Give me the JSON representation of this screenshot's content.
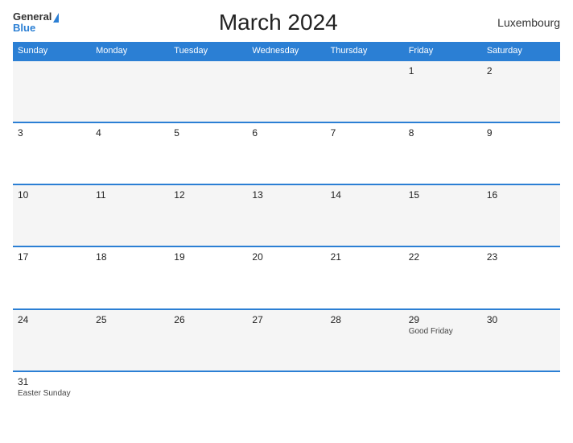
{
  "header": {
    "logo_general": "General",
    "logo_blue": "Blue",
    "title": "March 2024",
    "country": "Luxembourg"
  },
  "days_of_week": [
    "Sunday",
    "Monday",
    "Tuesday",
    "Wednesday",
    "Thursday",
    "Friday",
    "Saturday"
  ],
  "weeks": [
    [
      {
        "day": "",
        "event": ""
      },
      {
        "day": "",
        "event": ""
      },
      {
        "day": "",
        "event": ""
      },
      {
        "day": "",
        "event": ""
      },
      {
        "day": "",
        "event": ""
      },
      {
        "day": "1",
        "event": ""
      },
      {
        "day": "2",
        "event": ""
      }
    ],
    [
      {
        "day": "3",
        "event": ""
      },
      {
        "day": "4",
        "event": ""
      },
      {
        "day": "5",
        "event": ""
      },
      {
        "day": "6",
        "event": ""
      },
      {
        "day": "7",
        "event": ""
      },
      {
        "day": "8",
        "event": ""
      },
      {
        "day": "9",
        "event": ""
      }
    ],
    [
      {
        "day": "10",
        "event": ""
      },
      {
        "day": "11",
        "event": ""
      },
      {
        "day": "12",
        "event": ""
      },
      {
        "day": "13",
        "event": ""
      },
      {
        "day": "14",
        "event": ""
      },
      {
        "day": "15",
        "event": ""
      },
      {
        "day": "16",
        "event": ""
      }
    ],
    [
      {
        "day": "17",
        "event": ""
      },
      {
        "day": "18",
        "event": ""
      },
      {
        "day": "19",
        "event": ""
      },
      {
        "day": "20",
        "event": ""
      },
      {
        "day": "21",
        "event": ""
      },
      {
        "day": "22",
        "event": ""
      },
      {
        "day": "23",
        "event": ""
      }
    ],
    [
      {
        "day": "24",
        "event": ""
      },
      {
        "day": "25",
        "event": ""
      },
      {
        "day": "26",
        "event": ""
      },
      {
        "day": "27",
        "event": ""
      },
      {
        "day": "28",
        "event": ""
      },
      {
        "day": "29",
        "event": "Good Friday"
      },
      {
        "day": "30",
        "event": ""
      }
    ],
    [
      {
        "day": "31",
        "event": "Easter Sunday"
      },
      {
        "day": "",
        "event": ""
      },
      {
        "day": "",
        "event": ""
      },
      {
        "day": "",
        "event": ""
      },
      {
        "day": "",
        "event": ""
      },
      {
        "day": "",
        "event": ""
      },
      {
        "day": "",
        "event": ""
      }
    ]
  ]
}
